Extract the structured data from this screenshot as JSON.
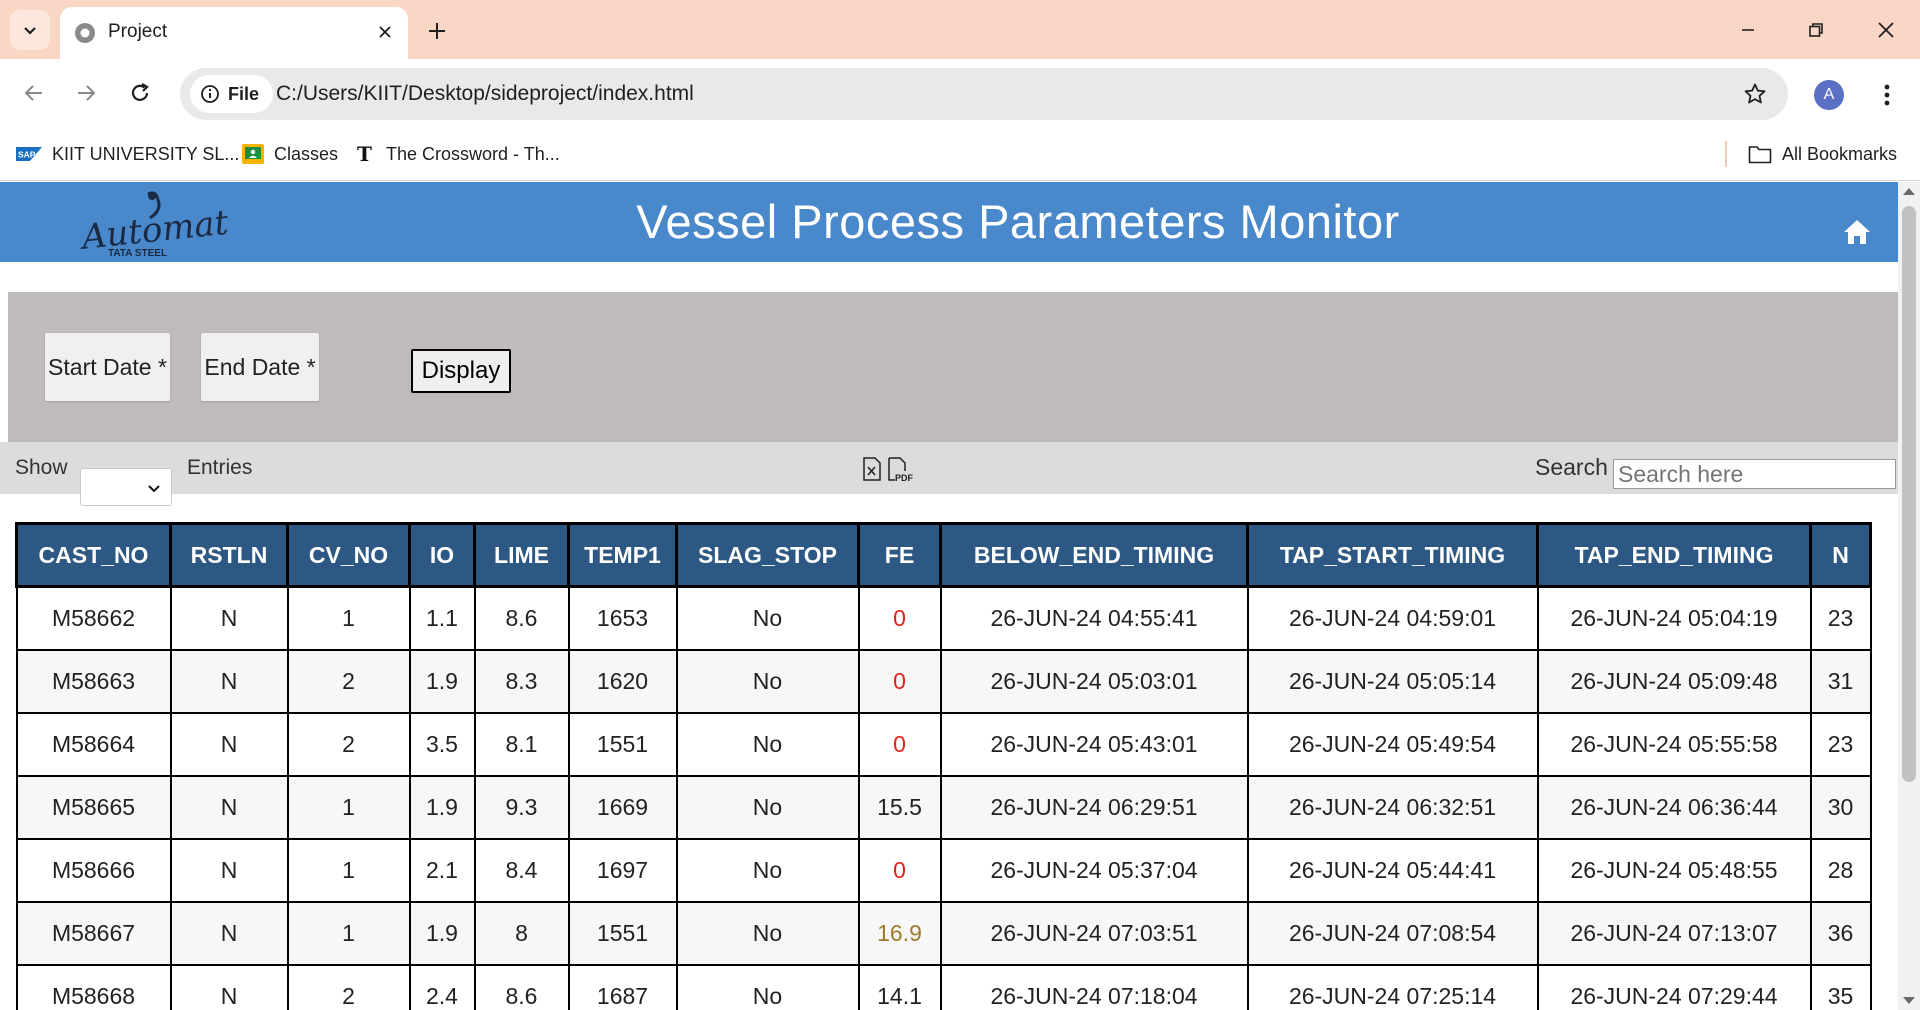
{
  "browser": {
    "tab_title": "Project",
    "site_chip": "File",
    "url": "C:/Users/KIIT/Desktop/sideproject/index.html",
    "profile_initial": "A",
    "bookmarks": [
      {
        "label": "KIIT UNIVERSITY SL...",
        "icon": "sap-icon"
      },
      {
        "label": "Classes",
        "icon": "classroom-icon"
      },
      {
        "label": "The Crossword - Th...",
        "icon": "nyt-icon"
      }
    ],
    "all_bookmarks": "All Bookmarks"
  },
  "header": {
    "logo_text": "Automation",
    "logo_subtext": "TATA STEEL",
    "title": "Vessel Process Parameters Monitor"
  },
  "filters": {
    "start_date": "Start Date *",
    "end_date": "End Date *",
    "display": "Display"
  },
  "controls": {
    "show_label": "Show",
    "entries_label": "Entries",
    "search_label": "Search",
    "search_placeholder": "Search here"
  },
  "table": {
    "columns": [
      "CAST_NO",
      "RSTLN",
      "CV_NO",
      "IO",
      "LIME",
      "TEMP1",
      "SLAG_STOP",
      "FE",
      "BELOW_END_TIMING",
      "TAP_START_TIMING",
      "TAP_END_TIMING",
      "N"
    ],
    "rows": [
      {
        "cells": [
          "M58662",
          "N",
          "1",
          "1.1",
          "8.6",
          "1653",
          "No",
          "0",
          "26-JUN-24 04:55:41",
          "26-JUN-24 04:59:01",
          "26-JUN-24 05:04:19",
          "23"
        ],
        "fe_color": "red"
      },
      {
        "cells": [
          "M58663",
          "N",
          "2",
          "1.9",
          "8.3",
          "1620",
          "No",
          "0",
          "26-JUN-24 05:03:01",
          "26-JUN-24 05:05:14",
          "26-JUN-24 05:09:48",
          "31"
        ],
        "fe_color": "red"
      },
      {
        "cells": [
          "M58664",
          "N",
          "2",
          "3.5",
          "8.1",
          "1551",
          "No",
          "0",
          "26-JUN-24 05:43:01",
          "26-JUN-24 05:49:54",
          "26-JUN-24 05:55:58",
          "23"
        ],
        "fe_color": "red"
      },
      {
        "cells": [
          "M58665",
          "N",
          "1",
          "1.9",
          "9.3",
          "1669",
          "No",
          "15.5",
          "26-JUN-24 06:29:51",
          "26-JUN-24 06:32:51",
          "26-JUN-24 06:36:44",
          "30"
        ],
        "fe_color": "normal"
      },
      {
        "cells": [
          "M58666",
          "N",
          "1",
          "2.1",
          "8.4",
          "1697",
          "No",
          "0",
          "26-JUN-24 05:37:04",
          "26-JUN-24 05:44:41",
          "26-JUN-24 05:48:55",
          "28"
        ],
        "fe_color": "red"
      },
      {
        "cells": [
          "M58667",
          "N",
          "1",
          "1.9",
          "8",
          "1551",
          "No",
          "16.9",
          "26-JUN-24 07:03:51",
          "26-JUN-24 07:08:54",
          "26-JUN-24 07:13:07",
          "36"
        ],
        "fe_color": "amber"
      },
      {
        "cells": [
          "M58668",
          "N",
          "2",
          "2.4",
          "8.6",
          "1687",
          "No",
          "14.1",
          "26-JUN-24 07:18:04",
          "26-JUN-24 07:25:14",
          "26-JUN-24 07:29:44",
          "35"
        ],
        "fe_color": "normal"
      }
    ]
  },
  "colors": {
    "header_bg": "#4a88cc",
    "table_header_bg": "#2d5883",
    "fe_red": "#e0241c",
    "fe_amber": "#a07a2c",
    "tabstrip_bg": "#fad7c4"
  }
}
